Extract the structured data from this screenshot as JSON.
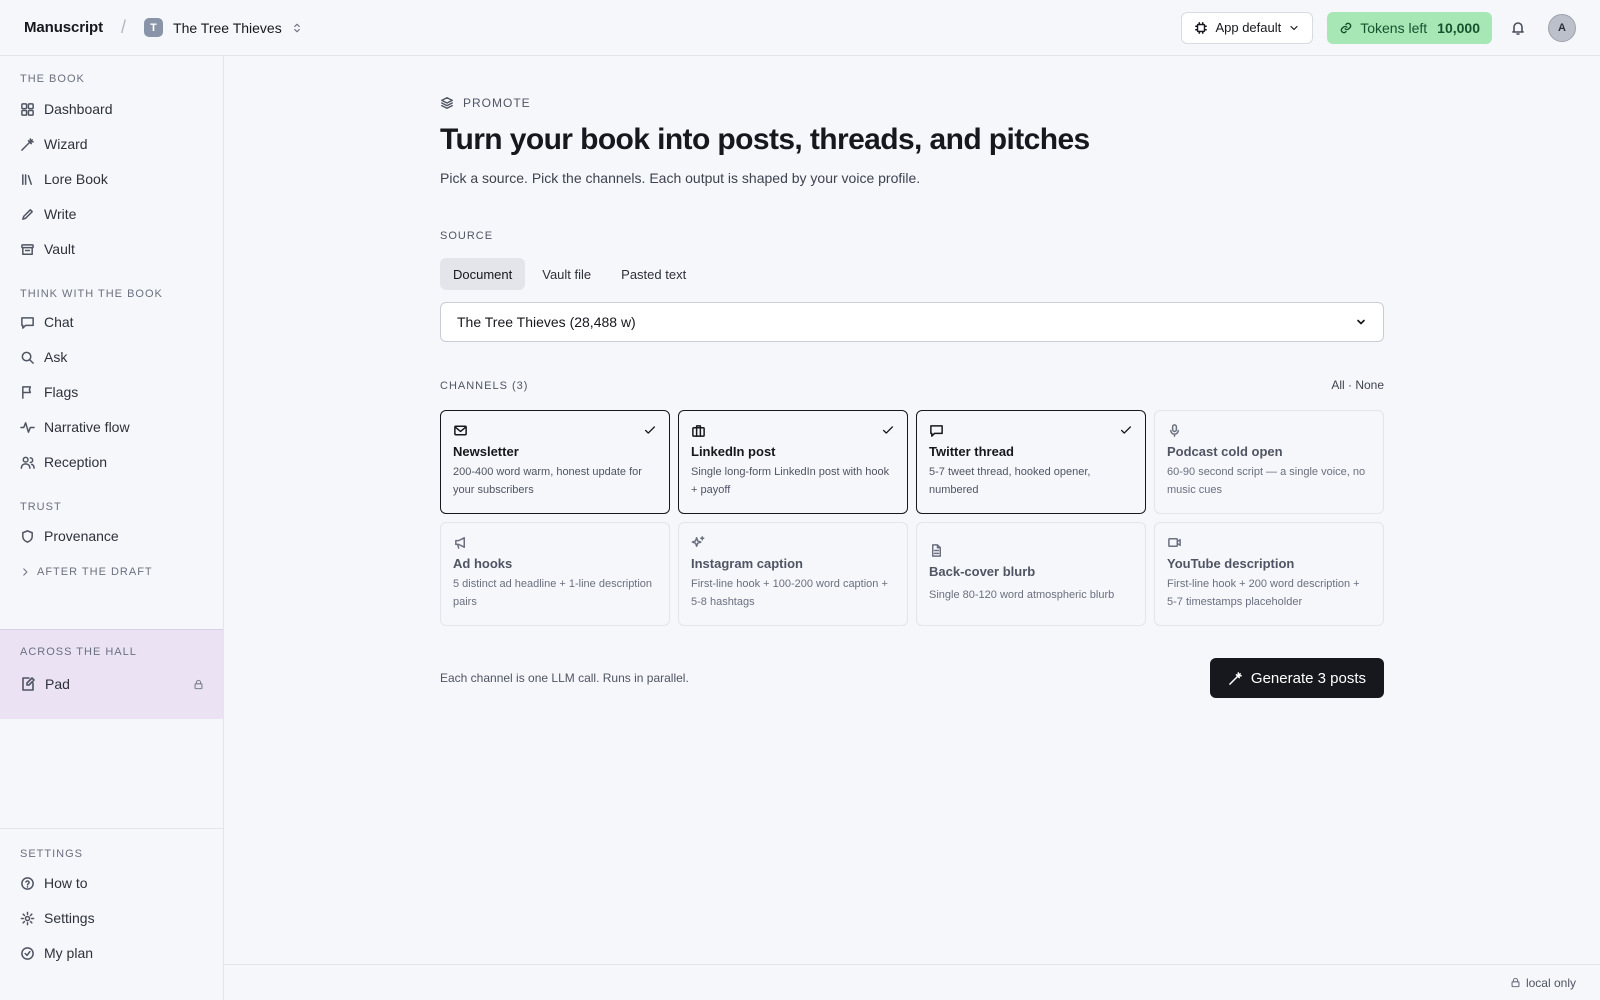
{
  "app": {
    "brand": "Manuscript",
    "separator": "/",
    "project_initial": "T",
    "project_name": "The Tree Thieves"
  },
  "topbar": {
    "model_label": "App default",
    "tokens_label": "Tokens left",
    "tokens_value": "10,000",
    "avatar_initial": "A"
  },
  "sidebar": {
    "sections": [
      {
        "title": "THE BOOK",
        "items": [
          {
            "label": "Dashboard",
            "icon": "grid-icon"
          },
          {
            "label": "Wizard",
            "icon": "wand-icon"
          },
          {
            "label": "Lore Book",
            "icon": "library-icon"
          },
          {
            "label": "Write",
            "icon": "pencil-icon"
          },
          {
            "label": "Vault",
            "icon": "archive-icon"
          }
        ]
      },
      {
        "title": "THINK WITH THE BOOK",
        "items": [
          {
            "label": "Chat",
            "icon": "chat-icon"
          },
          {
            "label": "Ask",
            "icon": "search-icon"
          },
          {
            "label": "Flags",
            "icon": "flag-icon"
          },
          {
            "label": "Narrative flow",
            "icon": "pulse-icon"
          },
          {
            "label": "Reception",
            "icon": "users-icon"
          }
        ]
      },
      {
        "title": "TRUST",
        "items": [
          {
            "label": "Provenance",
            "icon": "shield-icon"
          }
        ]
      }
    ],
    "after_draft": "AFTER THE DRAFT",
    "hall": {
      "title": "ACROSS THE HALL",
      "item": "Pad"
    },
    "settings": {
      "title": "SETTINGS",
      "items": [
        {
          "label": "How to",
          "icon": "help-icon"
        },
        {
          "label": "Settings",
          "icon": "gear-icon"
        },
        {
          "label": "My plan",
          "icon": "check-circle-icon"
        }
      ]
    }
  },
  "main": {
    "eyebrow": "PROMOTE",
    "title": "Turn your book into posts, threads, and pitches",
    "subtitle": "Pick a source. Pick the channels. Each output is shaped by your voice profile.",
    "source_label": "SOURCE",
    "source_tabs": [
      "Document",
      "Vault file",
      "Pasted text"
    ],
    "source_active": "Document",
    "source_selected": "The Tree Thieves (28,488 w)",
    "channels_label": "CHANNELS (3)",
    "all_none": "All · None",
    "channels": [
      {
        "title": "Newsletter",
        "desc": "200-400 word warm, honest update for your subscribers",
        "icon": "mail-icon",
        "selected": true
      },
      {
        "title": "LinkedIn post",
        "desc": "Single long-form LinkedIn post with hook + payoff",
        "icon": "briefcase-icon",
        "selected": true
      },
      {
        "title": "Twitter thread",
        "desc": "5-7 tweet thread, hooked opener, numbered",
        "icon": "message-icon",
        "selected": true
      },
      {
        "title": "Podcast cold open",
        "desc": "60-90 second script — a single voice, no music cues",
        "icon": "mic-icon",
        "selected": false
      },
      {
        "title": "Ad hooks",
        "desc": "5 distinct ad headline + 1-line description pairs",
        "icon": "megaphone-icon",
        "selected": false
      },
      {
        "title": "Instagram caption",
        "desc": "First-line hook + 100-200 word caption + 5-8 hashtags",
        "icon": "sparkles-icon",
        "selected": false
      },
      {
        "title": "Back-cover blurb",
        "desc": "Single 80-120 word atmospheric blurb",
        "icon": "file-icon",
        "selected": false
      },
      {
        "title": "YouTube description",
        "desc": "First-line hook + 200 word description + 5-7 timestamps placeholder",
        "icon": "video-icon",
        "selected": false
      }
    ],
    "footer_note": "Each channel is one LLM call. Runs in parallel.",
    "generate_label": "Generate 3 posts"
  },
  "status": {
    "label": "local only"
  },
  "colors": {
    "tokens_bg": "#a7e7b5",
    "hall_bg": "#ebe3f3",
    "primary": "#16181d"
  }
}
